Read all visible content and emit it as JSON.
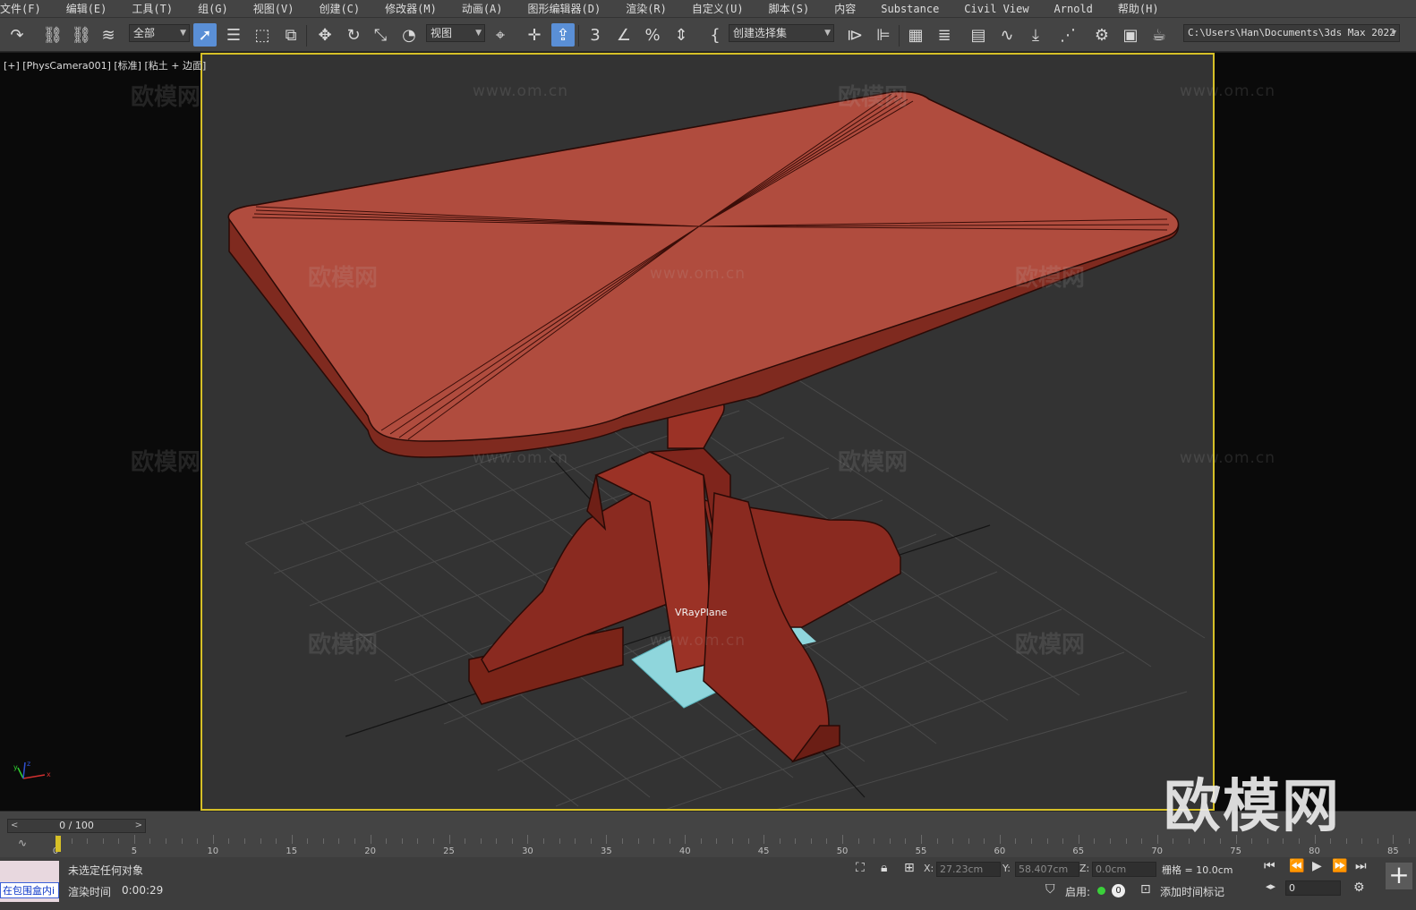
{
  "menubar": {
    "items": [
      "文件(F)",
      "编辑(E)",
      "工具(T)",
      "组(G)",
      "视图(V)",
      "创建(C)",
      "修改器(M)",
      "动画(A)",
      "图形编辑器(D)",
      "渲染(R)",
      "自定义(U)",
      "脚本(S)",
      "内容",
      "Substance",
      "Civil View",
      "Arnold",
      "帮助(H)"
    ]
  },
  "toolbar": {
    "selection_filter": "全部",
    "ref_coord": "视图",
    "named_selection": "创建选择集",
    "project_path": "C:\\Users\\Han\\Documents\\3ds Max 2022",
    "icons": [
      "undo-icon",
      "link-icon",
      "unlink-icon",
      "bind-space-warp-icon",
      "select-object-icon",
      "select-by-name-icon",
      "rect-selection-icon",
      "window-crossing-icon",
      "move-icon",
      "rotate-icon",
      "scale-icon",
      "placement-icon",
      "pivot-icon",
      "manipulate-icon",
      "keyboard-shortcut-icon",
      "snap-3d-icon",
      "angle-snap-icon",
      "percent-snap-icon",
      "spinner-snap-icon",
      "edit-named-sets-icon",
      "mirror-icon",
      "align-icon",
      "scene-explorer-icon",
      "layer-explorer-icon",
      "ribbon-icon",
      "curve-editor-icon",
      "schematic-icon",
      "material-editor-icon",
      "render-setup-icon",
      "rendered-frame-icon",
      "render-icon"
    ]
  },
  "viewport": {
    "label": "[+] [PhysCamera001] [标准] [粘土 + 边面]",
    "object_label": "VRayPlane",
    "watermark_text": "欧模网",
    "watermark_url": "www.om.cn",
    "brand_mark": "欧模网",
    "colors": {
      "table": "#b04c3e",
      "base": "#8a2a20",
      "plane": "#8fd6dc",
      "frame": "#d6c027"
    }
  },
  "timeline": {
    "frame_display": "0 / 100",
    "ticks": [
      0,
      5,
      10,
      15,
      20,
      25,
      30,
      35,
      40,
      45,
      50,
      55,
      60,
      65,
      70,
      75,
      80,
      85
    ]
  },
  "statusbar": {
    "maxscript_line": "在包围盒内i",
    "selection_status": "未选定任何对象",
    "render_time_label": "渲染时间",
    "render_time_value": "0:00:29",
    "x_label": "X:",
    "x_value": "27.23cm",
    "y_label": "Y:",
    "y_value": "58.407cm",
    "z_label": "Z:",
    "z_value": "0.0cm",
    "grid_label": "栅格 = 10.0cm",
    "enable_label": "启用:",
    "enable_count": "0",
    "add_time_tag": "添加时间标记",
    "frame_field": "0"
  }
}
